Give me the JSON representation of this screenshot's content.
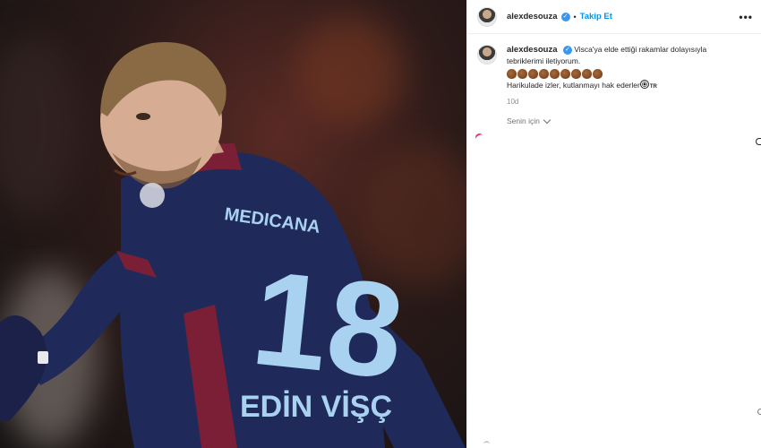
{
  "post": {
    "author": {
      "username": "alexdesouza",
      "verified": true,
      "follow_label": "Takip Et",
      "separator": "•"
    },
    "more_icon": "more-options-icon",
    "caption": {
      "username": "alexdesouza",
      "line1": "Visca'ya elde ettiği rakamlar dolayısıyla",
      "line2": "tebriklerimi iletiyorum.",
      "clap_emoji_count": 9,
      "line3": "Harikulade izler, kutlanmayı hak ederler",
      "flag_text": "TR",
      "time": "10d"
    },
    "sort": {
      "label": "Senin için"
    },
    "media": {
      "description_icon": "football-player-photo",
      "jersey_number": "18",
      "jersey_name": "EDİN VİŞÇ",
      "jersey_sponsor": "MEDICANA"
    },
    "colors": {
      "link_blue": "#0095f6",
      "verified_blue": "#3897f0",
      "jersey_navy": "#1f2a5a",
      "jersey_maroon": "#7a1f35",
      "number_light_blue": "#a9d2f0"
    }
  }
}
